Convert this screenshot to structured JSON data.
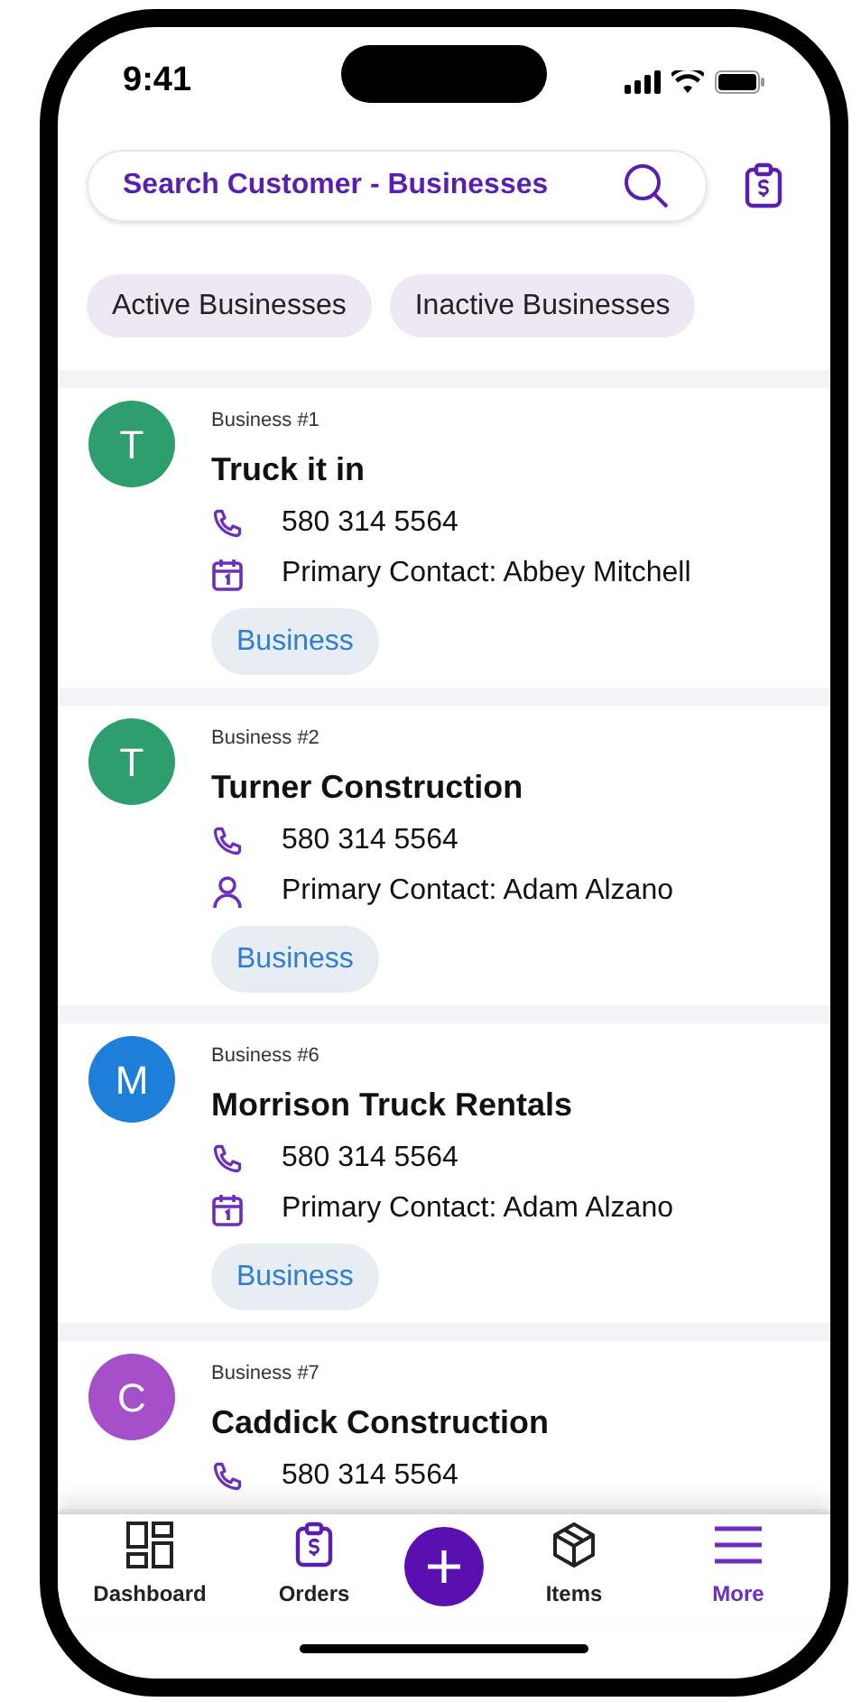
{
  "status_bar": {
    "time": "9:41"
  },
  "search": {
    "placeholder": "Search Customer - Businesses"
  },
  "filters": [
    {
      "label": "Active Businesses"
    },
    {
      "label": "Inactive Businesses"
    }
  ],
  "businesses": [
    {
      "initial": "T",
      "color": "#2e9e6e",
      "number": "Business #1",
      "name": "Truck it in",
      "details": [
        {
          "kind": "phone",
          "text": "580 314 5564"
        },
        {
          "kind": "calendar",
          "text": "Primary Contact: Abbey Mitchell"
        }
      ],
      "tag": "Business"
    },
    {
      "initial": "T",
      "color": "#2e9e6e",
      "number": "Business #2",
      "name": "Turner Construction",
      "details": [
        {
          "kind": "phone",
          "text": "580 314 5564"
        },
        {
          "kind": "person",
          "text": "Primary Contact: Adam Alzano"
        }
      ],
      "tag": "Business"
    },
    {
      "initial": "M",
      "color": "#1e7fd8",
      "number": "Business #6",
      "name": "Morrison Truck Rentals",
      "details": [
        {
          "kind": "phone",
          "text": "580 314 5564"
        },
        {
          "kind": "calendar",
          "text": "Primary Contact: Adam Alzano"
        }
      ],
      "tag": "Business"
    },
    {
      "initial": "C",
      "color": "#a54fc9",
      "number": "Business #7",
      "name": "Caddick Construction",
      "details": [
        {
          "kind": "phone",
          "text": "580 314 5564"
        }
      ]
    }
  ],
  "nav": [
    {
      "kind": "dashboard",
      "label": "Dashboard",
      "selected": false
    },
    {
      "kind": "orders",
      "label": "Orders",
      "selected": false
    },
    {
      "kind": "add"
    },
    {
      "kind": "items",
      "label": "Items",
      "selected": false
    },
    {
      "kind": "more",
      "label": "More",
      "selected": true
    }
  ]
}
